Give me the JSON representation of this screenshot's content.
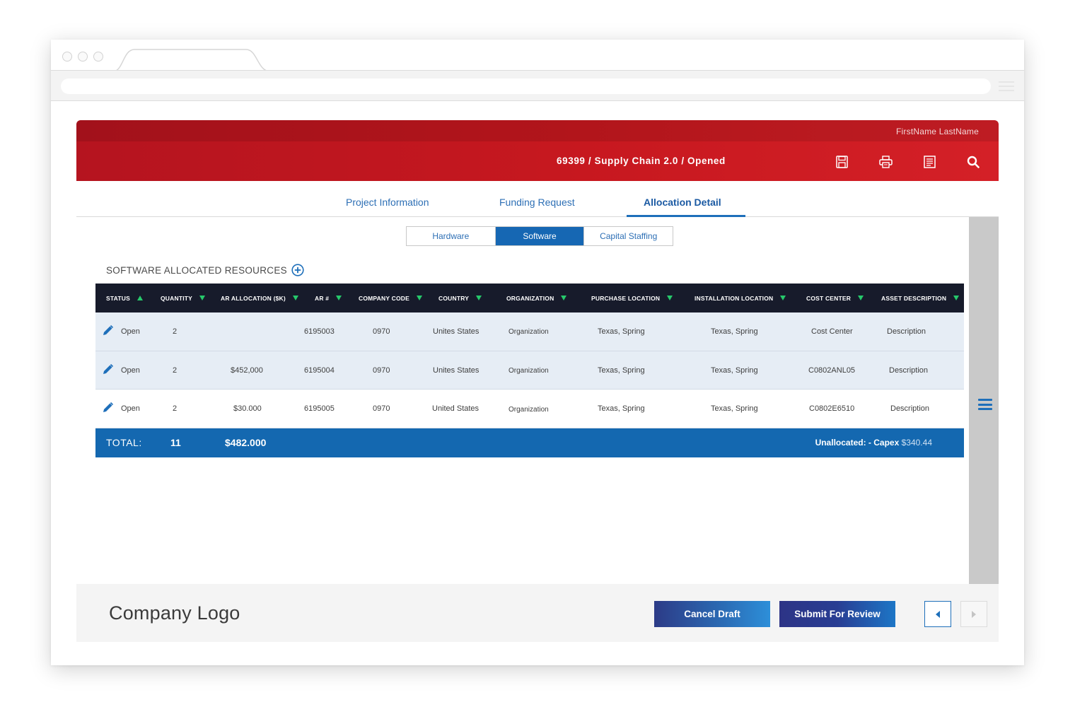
{
  "header": {
    "user_name": "FirstName LastName",
    "project_title": "69399 / Supply Chain 2.0 / Opened",
    "icons": [
      "save-icon",
      "print-icon",
      "document-icon",
      "search-icon"
    ],
    "brand_color": "#c7181f"
  },
  "tabs": {
    "project_information": "Project Information",
    "funding_request": "Funding Request",
    "allocation_detail": "Allocation Detail"
  },
  "subtabs": {
    "hardware": "Hardware",
    "software": "Software",
    "capital_staffing": "Capital Staffing",
    "active": "Software"
  },
  "section": {
    "title": "SOFTWARE ALLOCATED RESOURCES"
  },
  "table": {
    "columns": [
      {
        "label": "STATUS",
        "sort": "asc"
      },
      {
        "label": "QUANTITY",
        "sort": "desc"
      },
      {
        "label": "AR ALLOCATION ($K)",
        "sort": "desc"
      },
      {
        "label": "AR #",
        "sort": "desc"
      },
      {
        "label": "COMPANY CODE",
        "sort": "desc"
      },
      {
        "label": "COUNTRY",
        "sort": "desc"
      },
      {
        "label": "ORGANIZATION",
        "sort": "desc"
      },
      {
        "label": "PURCHASE LOCATION",
        "sort": "desc"
      },
      {
        "label": "INSTALLATION LOCATION",
        "sort": "desc"
      },
      {
        "label": "COST CENTER",
        "sort": "desc"
      },
      {
        "label": "ASSET DESCRIPTION",
        "sort": "desc"
      }
    ],
    "rows": [
      {
        "status": "Open",
        "quantity": "2",
        "ar_allocation": "",
        "ar_number": "6195003",
        "company_code": "0970",
        "country": "Unites States",
        "organization": "Organization",
        "purchase_location": "Texas, Spring",
        "installation_location": "Texas, Spring",
        "cost_center": "Cost Center",
        "asset_description": "Description"
      },
      {
        "status": "Open",
        "quantity": "2",
        "ar_allocation": "$452,000",
        "ar_number": "6195004",
        "company_code": "0970",
        "country": "Unites States",
        "organization": "Organization",
        "purchase_location": "Texas, Spring",
        "installation_location": "Texas, Spring",
        "cost_center": "C0802ANL05",
        "asset_description": "Description"
      },
      {
        "status": "Open",
        "quantity": "2",
        "ar_allocation": "$30.000",
        "ar_number": "6195005",
        "company_code": "0970",
        "country": "United States",
        "organization": "Organization",
        "purchase_location": "Texas, Spring",
        "installation_location": "Texas, Spring",
        "cost_center": "C0802E6510",
        "asset_description": "Description"
      }
    ],
    "total": {
      "label": "TOTAL:",
      "quantity": "11",
      "amount": "$482.000",
      "unallocated_label": "Unallocated: - Capex",
      "unallocated_value": "$340.44"
    }
  },
  "footer": {
    "logo": "Company Logo",
    "cancel_label": "Cancel Draft",
    "submit_label": "Submit For Review"
  }
}
